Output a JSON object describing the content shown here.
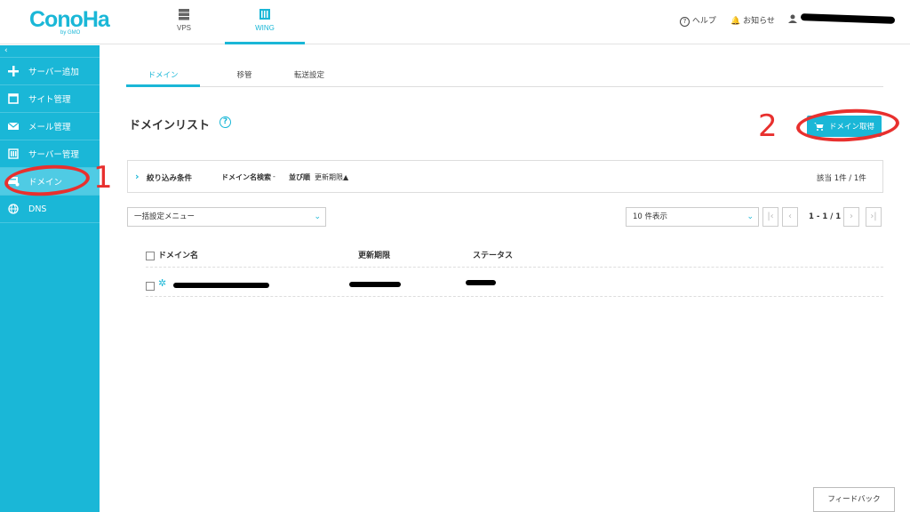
{
  "header": {
    "logo": "ConoHa",
    "logo_sub": "by GMO",
    "tabs": [
      {
        "label": "VPS",
        "icon": "server-icon",
        "active": false
      },
      {
        "label": "WING",
        "icon": "wing-icon",
        "active": true
      }
    ],
    "help_label": "ヘルプ",
    "notice_label": "お知らせ"
  },
  "sidebar": {
    "collapse": "‹",
    "items": [
      {
        "label": "サーバー追加",
        "icon": "plus-icon"
      },
      {
        "label": "サイト管理",
        "icon": "window-icon"
      },
      {
        "label": "メール管理",
        "icon": "mail-icon"
      },
      {
        "label": "サーバー管理",
        "icon": "server-manage-icon"
      },
      {
        "label": "ドメイン",
        "icon": "domain-icon",
        "active": true
      },
      {
        "label": "DNS",
        "icon": "globe-icon"
      }
    ]
  },
  "main": {
    "subtabs": [
      "ドメイン",
      "移管",
      "転送設定"
    ],
    "title": "ドメインリスト",
    "acquire_button": "ドメイン取得",
    "filter": {
      "label": "絞り込み条件",
      "search_label": "ドメイン名検索",
      "search_value": "-",
      "sort_label": "並び順",
      "sort_value": "更新期限▲",
      "count": "該当 1件 / 1件"
    },
    "bulk_menu": "一括設定メニュー",
    "per_page": "10 件表示",
    "page_range": "1 - 1 / 1",
    "table": {
      "headers": [
        "ドメイン名",
        "更新期限",
        "ステータス"
      ]
    },
    "feedback": "フィードバック"
  },
  "annotations": [
    "1",
    "2"
  ],
  "colors": {
    "accent": "#1ab7d7",
    "annotation": "#e8302e"
  }
}
